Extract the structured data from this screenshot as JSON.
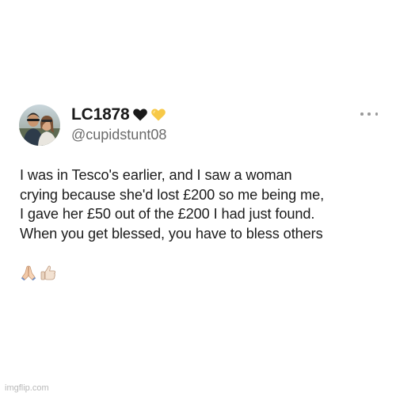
{
  "tweet": {
    "author": {
      "display_name": "LC1878",
      "name_emojis": [
        "black-heart-icon",
        "yellow-heart-icon"
      ],
      "handle": "@cupidstunt08"
    },
    "more_icon": "more-horizontal-icon",
    "body_lines": [
      "I was in Tesco's earlier, and I saw a woman",
      "crying because she'd lost £200 so me being me,",
      "I gave her £50 out of the £200 I had just found.",
      "When you get blessed, you have to bless others"
    ],
    "trailing_emojis": [
      "folded-hands-icon",
      "thumbs-up-icon"
    ]
  },
  "watermark": "imgflip.com",
  "colors": {
    "background": "#ffffff",
    "text": "#1c1c1c",
    "handle": "#6b6b6b",
    "black_heart": "#1a1a1a",
    "yellow_heart": "#f7c948",
    "watermark": "#b8b8b8"
  }
}
